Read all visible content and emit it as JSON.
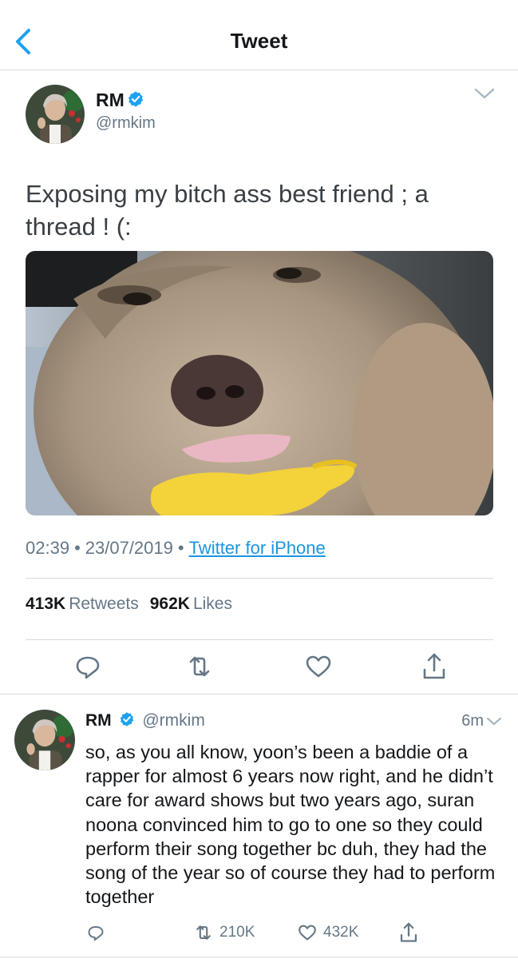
{
  "navbar": {
    "title": "Tweet"
  },
  "tweet": {
    "author": {
      "name": "RM",
      "handle": "@rmkim"
    },
    "text": "Exposing my bitch ass best friend ; a thread ! (:",
    "time": "02:39",
    "date": "23/07/2019",
    "source": "Twitter for iPhone",
    "stats": {
      "retweets_count": "413K",
      "retweets_label": "Retweets",
      "likes_count": "962K",
      "likes_label": "Likes"
    }
  },
  "reply": {
    "author": {
      "name": "RM",
      "handle": "@rmkim"
    },
    "time": "6m",
    "text": "so, as you all know, yoon’s been a baddie of a rapper for almost 6 years now right, and he didn’t care for award shows but two years ago, suran noona convinced him to go to one so they could perform their song together bc duh, they had the song of the year so of course they had to perform together",
    "retweets": "210K",
    "likes": "432K"
  },
  "icons": {
    "back": "chevron-left-icon",
    "verified": "verified-badge-icon",
    "caret": "chevron-down-icon",
    "reply": "reply-icon",
    "retweet": "retweet-icon",
    "like": "heart-icon",
    "share": "share-icon"
  },
  "colors": {
    "accent": "#1b95e0",
    "verified": "#1da1f2",
    "secondary_text": "#657786",
    "divider": "#d6dadd"
  }
}
